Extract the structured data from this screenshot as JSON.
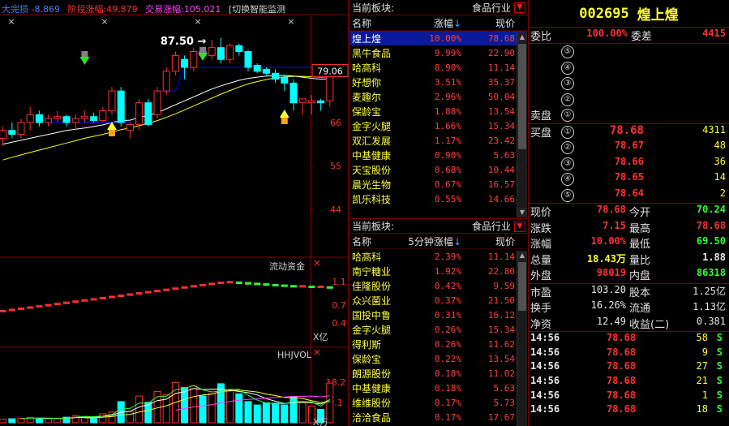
{
  "indicator_header": {
    "dapan": "大完损 -8.869",
    "jieduan": "阶段涨幅:49.879",
    "jiaoyi": "交易涨幅:105.021",
    "switch_text": "[切换智能监测"
  },
  "main_chart": {
    "high_label": "87.50",
    "price_box": "79.06",
    "y_ticks": [
      "66",
      "55",
      "44"
    ]
  },
  "flow_panel": {
    "title": "流动资金",
    "y_ticks": [
      "1.1",
      "0.7",
      "0.4"
    ],
    "unit": "X亿"
  },
  "vol_panel": {
    "title": "HHJVOL",
    "y_ticks": [
      "18.2",
      "9.1"
    ],
    "unit": "X万"
  },
  "colors": {
    "up": "#ff3030",
    "down": "#00ffff",
    "ma1": "#ffffff",
    "ma2": "#ffff00",
    "ma3": "#0000ff"
  },
  "chart_data": {
    "type": "candlestick",
    "candles": [
      {
        "o": 62,
        "h": 65,
        "l": 60,
        "c": 64
      },
      {
        "o": 64,
        "h": 66,
        "l": 62,
        "c": 63
      },
      {
        "o": 63,
        "h": 67,
        "l": 62,
        "c": 66
      },
      {
        "o": 66,
        "h": 70,
        "l": 64,
        "c": 68
      },
      {
        "o": 68,
        "h": 69,
        "l": 65,
        "c": 66
      },
      {
        "o": 66,
        "h": 68,
        "l": 65,
        "c": 67
      },
      {
        "o": 67,
        "h": 69,
        "l": 66,
        "c": 67.5
      },
      {
        "o": 67.5,
        "h": 68,
        "l": 65,
        "c": 66
      },
      {
        "o": 66,
        "h": 68,
        "l": 64,
        "c": 67
      },
      {
        "o": 67,
        "h": 69,
        "l": 66,
        "c": 67.5
      },
      {
        "o": 67.5,
        "h": 68.5,
        "l": 66,
        "c": 66.5
      },
      {
        "o": 66.5,
        "h": 70,
        "l": 66,
        "c": 69
      },
      {
        "o": 69,
        "h": 75,
        "l": 68,
        "c": 74
      },
      {
        "o": 74,
        "h": 75,
        "l": 65,
        "c": 66
      },
      {
        "o": 64,
        "h": 66,
        "l": 62,
        "c": 65.5
      },
      {
        "o": 65.5,
        "h": 72,
        "l": 64,
        "c": 71
      },
      {
        "o": 71,
        "h": 72,
        "l": 65,
        "c": 65.5
      },
      {
        "o": 68,
        "h": 75,
        "l": 67,
        "c": 74
      },
      {
        "o": 74,
        "h": 80,
        "l": 73,
        "c": 79
      },
      {
        "o": 79,
        "h": 84,
        "l": 78,
        "c": 83
      },
      {
        "o": 82,
        "h": 83,
        "l": 77,
        "c": 80
      },
      {
        "o": 80,
        "h": 85,
        "l": 79,
        "c": 84
      },
      {
        "o": 84,
        "h": 85,
        "l": 82,
        "c": 83
      },
      {
        "o": 83,
        "h": 87,
        "l": 82,
        "c": 85
      },
      {
        "o": 85,
        "h": 87.5,
        "l": 81,
        "c": 82
      },
      {
        "o": 82,
        "h": 86,
        "l": 81,
        "c": 85.5
      },
      {
        "o": 85.5,
        "h": 86,
        "l": 83,
        "c": 84
      },
      {
        "o": 84,
        "h": 84.5,
        "l": 79,
        "c": 80
      },
      {
        "o": 80.5,
        "h": 81,
        "l": 78.5,
        "c": 79
      },
      {
        "o": 79.5,
        "h": 80,
        "l": 78,
        "c": 78.5
      },
      {
        "o": 78.5,
        "h": 79.5,
        "l": 76,
        "c": 77
      },
      {
        "o": 77.5,
        "h": 78,
        "l": 74,
        "c": 76
      },
      {
        "o": 76,
        "h": 77,
        "l": 69,
        "c": 71
      },
      {
        "o": 71,
        "h": 72,
        "l": 68,
        "c": 72
      },
      {
        "o": 71,
        "h": 73,
        "l": 68,
        "c": 71.5
      },
      {
        "o": 71.5,
        "h": 72,
        "l": 69,
        "c": 71
      },
      {
        "o": 71.5,
        "h": 79.06,
        "l": 70,
        "c": 78.68
      }
    ],
    "ma_white": [
      60.5,
      61,
      61.5,
      62,
      62.5,
      63,
      63.5,
      64,
      64.3,
      64.6,
      65,
      65.4,
      66,
      66.5,
      66.6,
      67.3,
      67.8,
      68.5,
      69.5,
      70.5,
      71.5,
      72.5,
      73.5,
      74.5,
      75.3,
      76,
      76.7,
      77.2,
      77.5,
      77.8,
      77.9,
      78,
      77.8,
      77.5,
      77.2,
      77,
      77.1
    ],
    "ma_yellow": [
      56.5,
      57.2,
      57.8,
      58.4,
      59,
      59.6,
      60.2,
      60.8,
      61.4,
      62,
      62.5,
      63,
      63.6,
      64.2,
      64.6,
      65.2,
      65.8,
      66.5,
      67.3,
      68.2,
      69.2,
      70.2,
      71.2,
      72.2,
      73.2,
      74.1,
      75,
      75.8,
      76.4,
      76.9,
      77.3,
      77.6,
      77.7,
      77.7,
      77.6,
      77.5,
      77.6
    ],
    "ma_blue": [
      null,
      null,
      null,
      null,
      null,
      66,
      66,
      66,
      66,
      66,
      66,
      66,
      66,
      66,
      66,
      null,
      null,
      74,
      74,
      74,
      80,
      80,
      80,
      80,
      80,
      80,
      80,
      80,
      80,
      80,
      80,
      80,
      80,
      80,
      80,
      80,
      null
    ],
    "flow": [
      0.6,
      0.62,
      0.64,
      0.66,
      0.68,
      0.7,
      0.72,
      0.74,
      0.76,
      0.78,
      0.8,
      0.82,
      0.84,
      0.86,
      0.88,
      0.9,
      0.92,
      0.94,
      0.96,
      0.98,
      1.0,
      1.02,
      1.04,
      1.06,
      1.08,
      1.09,
      1.08,
      1.07,
      1.06,
      1.05,
      1.04,
      1.03,
      1.02,
      1.02,
      1.01,
      1.01,
      1.0
    ],
    "volume": [
      1.5,
      1.8,
      2.0,
      2.4,
      2.0,
      1.8,
      1.9,
      2.5,
      3.1,
      2.8,
      2.3,
      4.0,
      4.8,
      9.5,
      5.0,
      12.0,
      9.2,
      14.0,
      12.5,
      18.0,
      15.8,
      16.5,
      12.0,
      13.0,
      17.5,
      14.5,
      13.0,
      9.5,
      8.0,
      9.0,
      8.8,
      8.0,
      11.5,
      9.0,
      7.5,
      6.0,
      17.8
    ]
  },
  "board1": {
    "label": "当前板块:",
    "industry": "食品行业",
    "col_name": "名称",
    "col_change": "涨幅",
    "col_price": "现价",
    "rows": [
      {
        "name": "煌上煌",
        "change": "10.00%",
        "price": "78.68"
      },
      {
        "name": "黑牛食品",
        "change": "9.99%",
        "price": "22.90"
      },
      {
        "name": "哈高科",
        "change": "8.90%",
        "price": "11.14"
      },
      {
        "name": "好想你",
        "change": "3.51%",
        "price": "35.37"
      },
      {
        "name": "麦趣尔",
        "change": "2.96%",
        "price": "50.04"
      },
      {
        "name": "保龄宝",
        "change": "1.88%",
        "price": "13.54"
      },
      {
        "name": "金字火腿",
        "change": "1.66%",
        "price": "15.34"
      },
      {
        "name": "双汇发展",
        "change": "1.17%",
        "price": "23.42"
      },
      {
        "name": "中基健康",
        "change": "0.90%",
        "price": "5.63"
      },
      {
        "name": "天宝股份",
        "change": "0.68%",
        "price": "10.44"
      },
      {
        "name": "晨光生物",
        "change": "0.67%",
        "price": "16.57"
      },
      {
        "name": "凯乐科技",
        "change": "0.55%",
        "price": "14.66"
      }
    ]
  },
  "board2": {
    "label": "当前板块:",
    "industry": "食品行业",
    "col_name": "名称",
    "col_change": "5分钟涨幅",
    "col_price": "现价",
    "rows": [
      {
        "name": "哈高科",
        "change": "2.39%",
        "price": "11.14"
      },
      {
        "name": "南宁糖业",
        "change": "1.92%",
        "price": "22.80"
      },
      {
        "name": "佳隆股份",
        "change": "0.42%",
        "price": "9.59"
      },
      {
        "name": "众兴菌业",
        "change": "0.37%",
        "price": "21.50"
      },
      {
        "name": "国投中鲁",
        "change": "0.31%",
        "price": "16.12"
      },
      {
        "name": "金字火腿",
        "change": "0.26%",
        "price": "15.34"
      },
      {
        "name": "得利斯",
        "change": "0.26%",
        "price": "11.62"
      },
      {
        "name": "保龄宝",
        "change": "0.22%",
        "price": "13.54"
      },
      {
        "name": "朗源股份",
        "change": "0.18%",
        "price": "11.02"
      },
      {
        "name": "中基健康",
        "change": "0.18%",
        "price": "5.63"
      },
      {
        "name": "维维股份",
        "change": "0.17%",
        "price": "5.73"
      },
      {
        "name": "洽洽食品",
        "change": "0.17%",
        "price": "17.67"
      }
    ]
  },
  "quote": {
    "code": "002695",
    "name": "煌上煌",
    "weibi_label": "委比",
    "weibi": "100.00%",
    "weicha_label": "委差",
    "weicha": "4415",
    "sell_label": "卖盘",
    "buy_label": "买盘",
    "sell_levels": [
      "⑤",
      "④",
      "③",
      "②",
      "①"
    ],
    "buy": [
      {
        "lvl": "①",
        "price": "78.68",
        "vol": "4311"
      },
      {
        "lvl": "②",
        "price": "78.67",
        "vol": "48"
      },
      {
        "lvl": "③",
        "price": "78.66",
        "vol": "36"
      },
      {
        "lvl": "④",
        "price": "78.65",
        "vol": "14"
      },
      {
        "lvl": "⑤",
        "price": "78.64",
        "vol": "2"
      }
    ],
    "stats": [
      {
        "k1": "现价",
        "v1": "78.68",
        "c1": "red",
        "k2": "今开",
        "v2": "70.24",
        "c2": "green"
      },
      {
        "k1": "涨跌",
        "v1": "7.15",
        "c1": "red",
        "k2": "最高",
        "v2": "78.68",
        "c2": "red"
      },
      {
        "k1": "涨幅",
        "v1": "10.00%",
        "c1": "red",
        "k2": "最低",
        "v2": "69.50",
        "c2": "green"
      },
      {
        "k1": "总量",
        "v1": "18.43万",
        "c1": "yellow",
        "k2": "量比",
        "v2": "1.88",
        "c2": "white"
      },
      {
        "k1": "外盘",
        "v1": "98019",
        "c1": "red",
        "k2": "内盘",
        "v2": "86318",
        "c2": "green"
      }
    ],
    "stats2": [
      {
        "k1": "市盈",
        "v1": "103.20",
        "k2": "股本",
        "v2": "1.25亿"
      },
      {
        "k1": "换手",
        "v1": "16.26%",
        "k2": "流通",
        "v2": "1.13亿"
      },
      {
        "k1": "净资",
        "v1": "12.49",
        "k2": "收益(二)",
        "v2": "0.381"
      }
    ],
    "ticks": [
      {
        "time": "14:56",
        "price": "78.68",
        "vol": "58",
        "bs": "S"
      },
      {
        "time": "14:56",
        "price": "78.68",
        "vol": "9",
        "bs": "S"
      },
      {
        "time": "14:56",
        "price": "78.68",
        "vol": "27",
        "bs": "S"
      },
      {
        "time": "14:56",
        "price": "78.68",
        "vol": "21",
        "bs": "S"
      },
      {
        "time": "14:56",
        "price": "78.68",
        "vol": "1",
        "bs": "S"
      },
      {
        "time": "14:56",
        "price": "78.68",
        "vol": "18",
        "bs": "S"
      }
    ]
  }
}
